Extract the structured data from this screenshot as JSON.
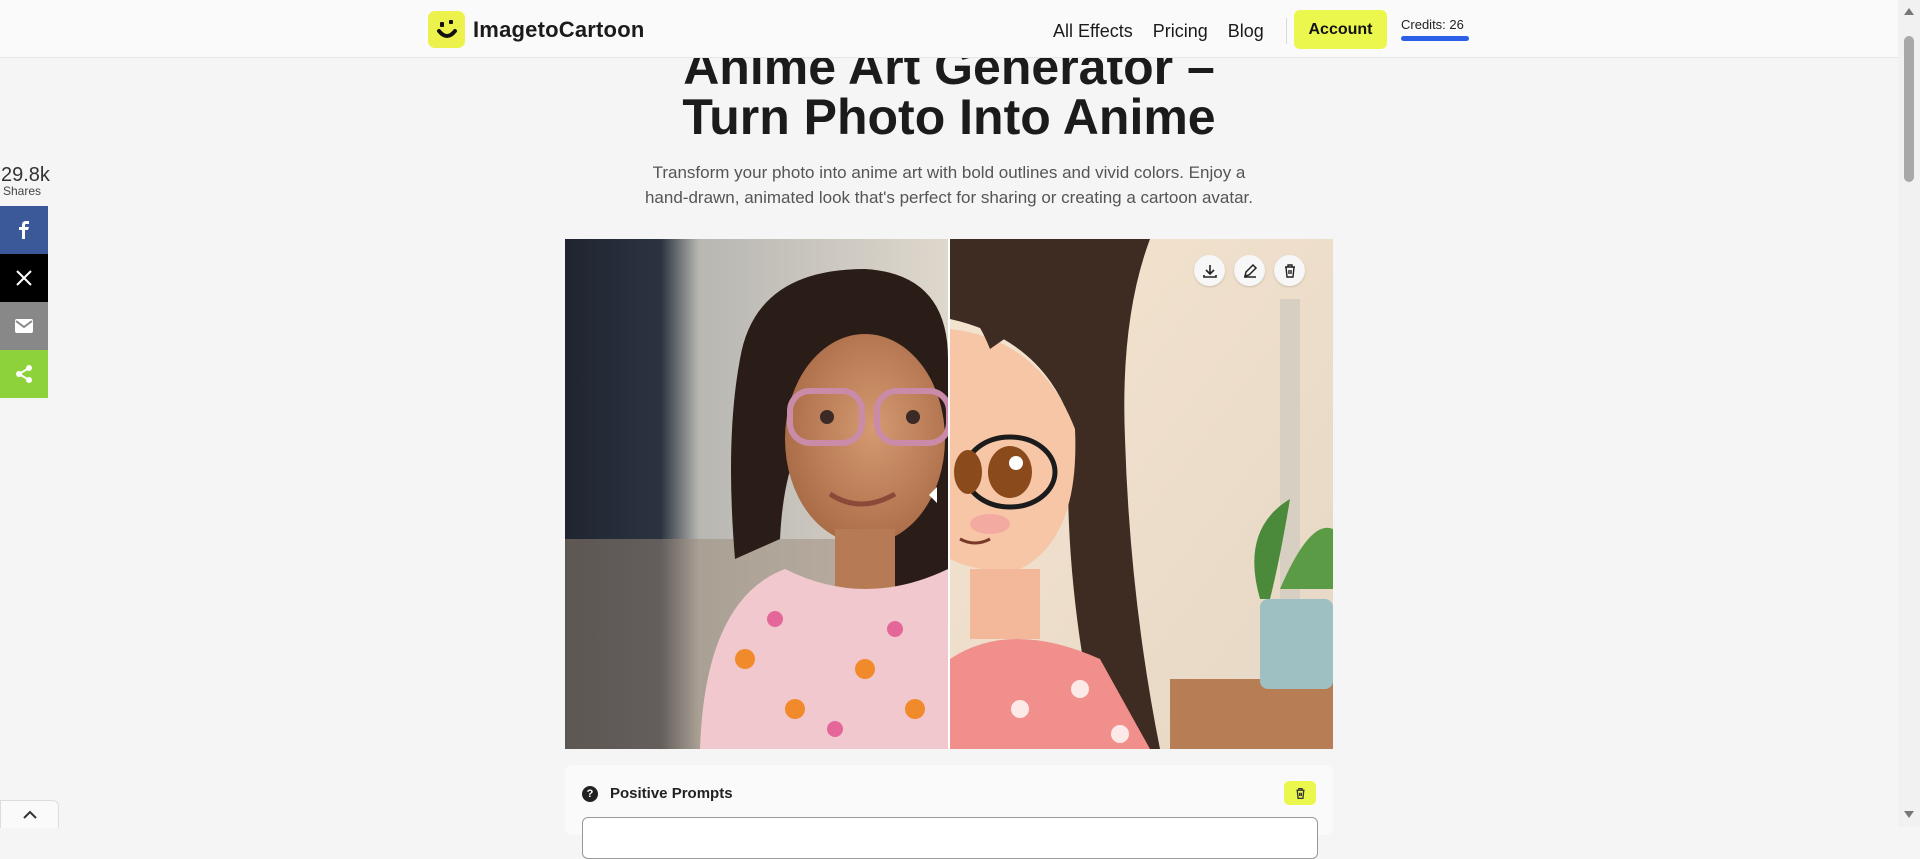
{
  "header": {
    "logo_text": "ImagetoCartoon",
    "logo_icon": "smiley-face-icon",
    "nav": [
      "All Effects",
      "Pricing",
      "Blog"
    ],
    "account_label": "Account",
    "credits_text": "Credits: 26",
    "brand_color": "#ecf74e",
    "credits_bar_color": "#2c5ee8"
  },
  "hero": {
    "title_line1": "Anime Art Generator –",
    "title_line2": "Turn Photo Into Anime",
    "subtitle_line1": "Transform your photo into anime art with bold outlines and vivid colors. Enjoy a",
    "subtitle_line2": "hand-drawn, animated look that's perfect for sharing or creating a cartoon avatar."
  },
  "share": {
    "count": "29.8k",
    "label": "Shares",
    "buttons": [
      "facebook-icon",
      "x-icon",
      "email-icon",
      "share-icon"
    ]
  },
  "compare": {
    "actions": [
      "download-icon",
      "edit-icon",
      "delete-icon"
    ]
  },
  "prompts": {
    "title": "Positive Prompts",
    "input_value": ""
  }
}
